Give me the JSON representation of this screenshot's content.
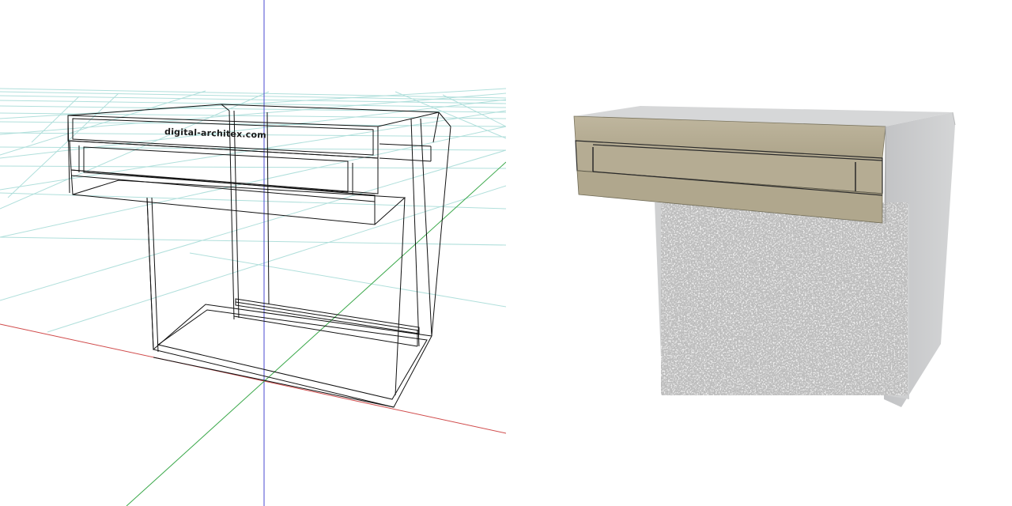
{
  "watermark": {
    "text": "digital-architex.com"
  },
  "colors": {
    "grid_line": "#a8dcd8",
    "axis_x": "#d04a4a",
    "axis_y": "#3aa84a",
    "axis_z": "#4a4ad0",
    "wireframe": "#111111",
    "drawer_front": "#b5ac93",
    "drawer_top": "#c7c0ab",
    "cabinet_side": "#c9cacb",
    "cabinet_top": "#d8d9da",
    "stone": "#9a9a9a"
  },
  "views": {
    "left": "wireframe-icon",
    "right": "rendered-cabinet-icon"
  }
}
